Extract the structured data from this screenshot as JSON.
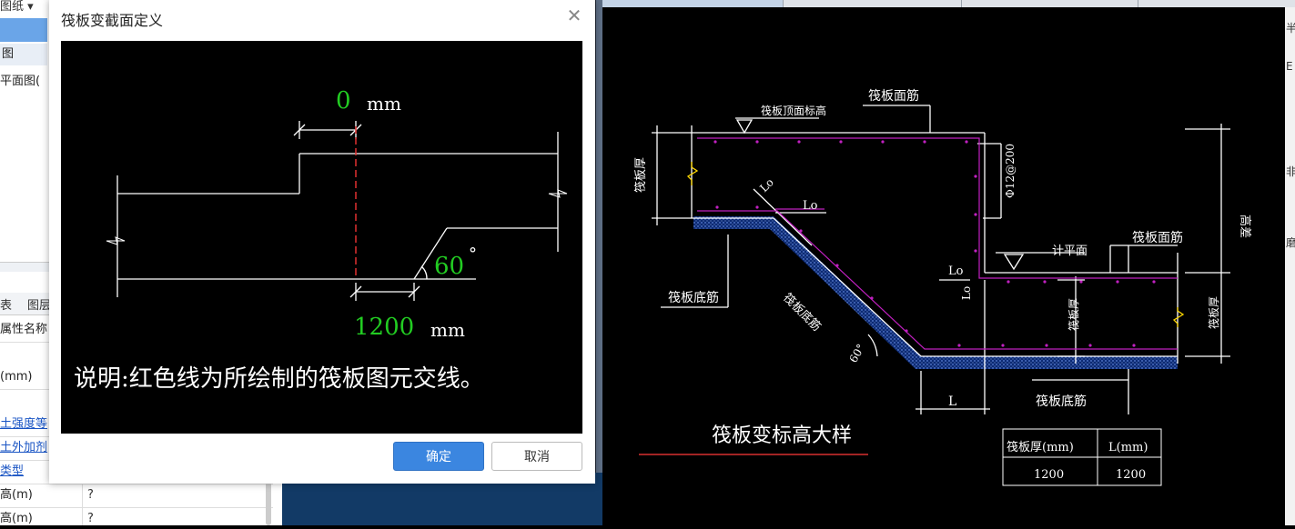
{
  "left_panel": {
    "top_tab": "图纸 ▾",
    "header": "图",
    "item": "平面图(",
    "tabs": [
      "表",
      "图层"
    ],
    "rows": [
      {
        "key": "属性名称",
        "value": "",
        "link": false
      },
      {
        "key": "(mm)",
        "value": "",
        "link": false
      },
      {
        "key": "土强度等",
        "value": "",
        "link": true
      },
      {
        "key": "土外加剂",
        "value": "",
        "link": true
      },
      {
        "key": "类型",
        "value": "",
        "link": true
      },
      {
        "key": "高(m)",
        "value": "?",
        "link": false
      },
      {
        "key": "高(m)",
        "value": "?",
        "link": false
      }
    ]
  },
  "dialog": {
    "title": "筏板变截面定义",
    "close_glyph": "✕",
    "offset_value": "0",
    "offset_unit": "mm",
    "width_value": "1200",
    "width_unit": "mm",
    "angle_value": "60",
    "angle_unit": "°",
    "note": "说明:红色线为所绘制的筏板图元交线。",
    "ok_label": "确定",
    "cancel_label": "取消"
  },
  "cad": {
    "title": "筏板变标高大样",
    "labels": {
      "top_elev": "筏板顶面标高",
      "top_rebar": "筏板面筋",
      "thickness": "筏板厚",
      "rebar_spec": "Φ12@200",
      "height_diff": "高差",
      "lo": "Lo",
      "bottom_rebar": "筏板底筋",
      "level_face": "计平面",
      "angle": "60°",
      "length": "L"
    },
    "table": {
      "headers": [
        "筏板厚(mm)",
        "L(mm)"
      ],
      "values": [
        "1200",
        "1200"
      ]
    }
  },
  "side_chars": [
    "半",
    "E",
    "非",
    "磨"
  ],
  "colors": {
    "cad_line": "#ffffff",
    "rebar": "#c020c0",
    "dialog_value": "#22cc22",
    "section_line": "#e03030",
    "ok_button": "#3b86e0",
    "concrete": "#1a3a8a"
  }
}
